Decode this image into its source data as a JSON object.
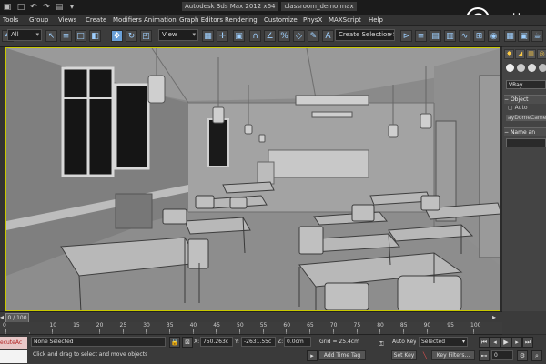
{
  "titlebar": {
    "app_title": "Autodesk 3ds Max 2012 x64",
    "file_name": "classroom_demo.max"
  },
  "menu": [
    {
      "label": "Tools"
    },
    {
      "label": "Group"
    },
    {
      "label": "Views"
    },
    {
      "label": "Create"
    },
    {
      "label": "Modifiers"
    },
    {
      "label": "Animation"
    },
    {
      "label": "Graph Editors"
    },
    {
      "label": "Rendering"
    },
    {
      "label": "Customize"
    },
    {
      "label": "PhysX"
    },
    {
      "label": "MAXScript"
    },
    {
      "label": "Help"
    }
  ],
  "toolbar": {
    "selection_filter": "All",
    "reference_coord": "View",
    "named_selection": "Create Selection Se",
    "snap_percent": "%",
    "snap_number": "3"
  },
  "watermark": {
    "letter": "G",
    "text": "matt g"
  },
  "command_panel": {
    "renderer_dropdown": "VRay",
    "section_object_type": "Object",
    "autogrid_label": "Auto",
    "dome_camera": "ayDomeCame",
    "section_name": "Name an"
  },
  "timeline": {
    "frame_counter": "0 / 100",
    "ticks": [
      "0",
      "10",
      "15",
      "20",
      "25",
      "30",
      "35",
      "40",
      "45",
      "50",
      "55",
      "60",
      "65",
      "70",
      "75",
      "80",
      "85",
      "90",
      "95",
      "100"
    ]
  },
  "status_bar": {
    "maxscript_text": "ecuteAc",
    "selection_status": "None Selected",
    "prompt": "Click and drag to select and move objects",
    "x_label": "X:",
    "x_value": "750.263c",
    "y_label": "Y:",
    "y_value": "-2631.55c",
    "z_label": "Z:",
    "z_value": "0.0cm",
    "grid": "Grid = 25.4cm",
    "add_time_tag": "Add Time Tag",
    "auto_key": "Auto Key",
    "set_key": "Set Key",
    "key_mode": "Selected",
    "key_filters": "Key Filters...",
    "current_frame": "0"
  },
  "colors": {
    "viewport_bg": "#8a8a8a",
    "viewport_border": "#c8c800",
    "maxscript_bg": "#e8c8c8"
  }
}
